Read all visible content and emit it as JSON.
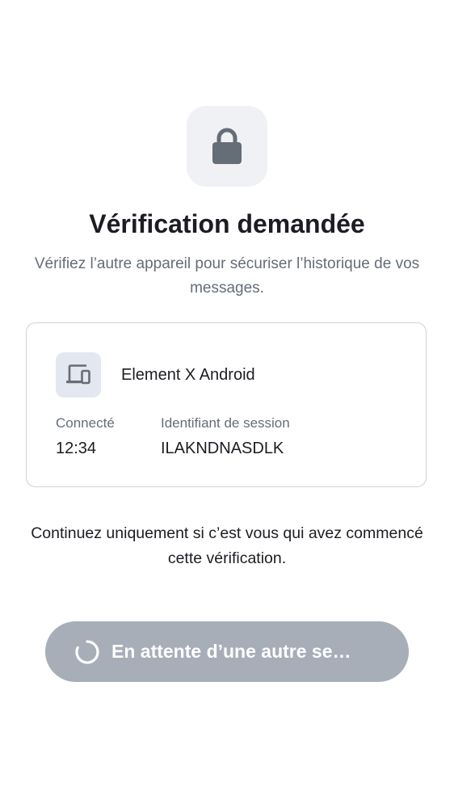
{
  "header": {
    "icon": "lock-icon",
    "title": "Vérification demandée",
    "subtitle": "Vérifiez l’autre appareil pour sécuriser l’historique de vos messages."
  },
  "session_card": {
    "device_icon": "devices-icon",
    "device_name": "Element X Android",
    "connected_label": "Connecté",
    "connected_value": "12:34",
    "session_id_label": "Identifiant de session",
    "session_id_value": "ILAKNDNASDLK"
  },
  "notice": "Continuez uniquement si c’est vous qui avez commencé cette vérification.",
  "waiting_button": {
    "label": "En attente d’une autre se…",
    "icon": "spinner-icon",
    "enabled": false
  },
  "colors": {
    "background": "#ffffff",
    "tile_background": "#eff1f5",
    "icon_gray": "#656d77",
    "primary_text": "#1b1d22",
    "secondary_text": "#656d77",
    "card_border": "#cdd1d8",
    "button_disabled": "#a7aeb8"
  }
}
